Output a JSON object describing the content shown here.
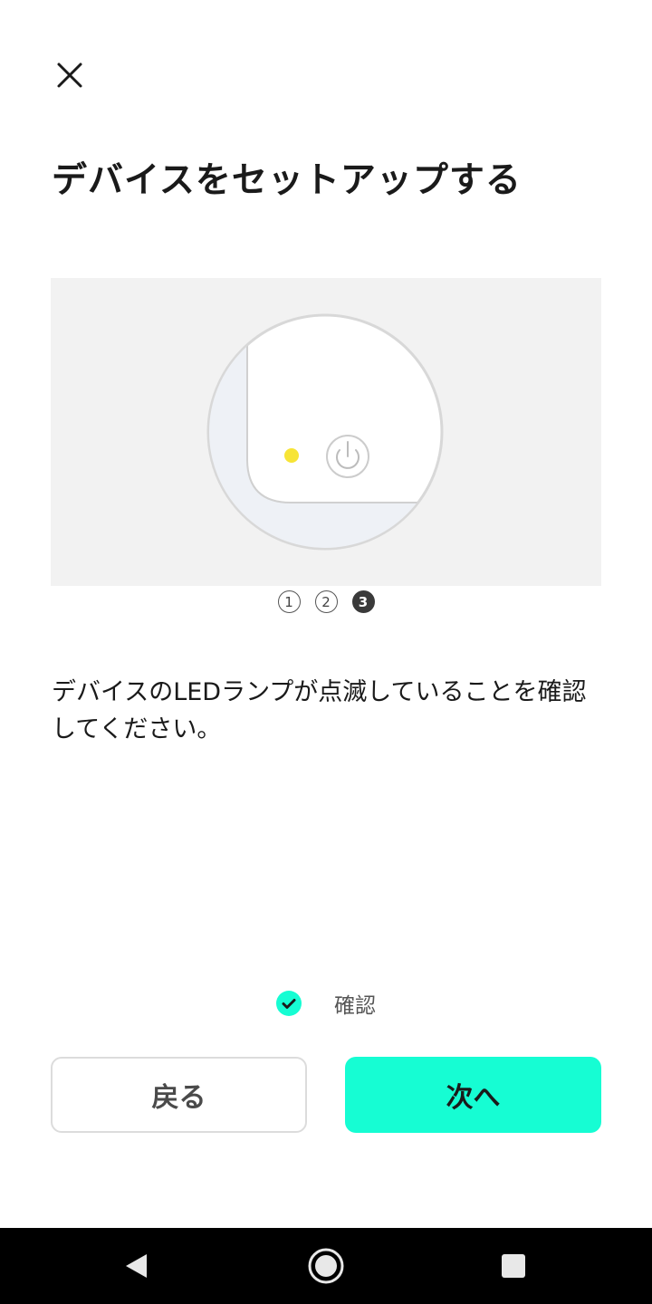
{
  "header": {
    "close_icon": "close-icon",
    "title": "デバイスをセットアップする"
  },
  "illustration": {
    "description_icon": "device-led-illustration",
    "led_color": "#f7e436"
  },
  "steps": {
    "items": [
      "1",
      "2",
      "3"
    ],
    "current": 3
  },
  "instruction": {
    "text": "デバイスのLEDランプが点滅していることを確認してください。"
  },
  "confirm": {
    "checked": true,
    "label": "確認"
  },
  "buttons": {
    "back_label": "戻る",
    "next_label": "次へ"
  },
  "colors": {
    "accent": "#16fdd3",
    "text": "#1a1a1a"
  },
  "system_nav": {
    "back_icon": "back-triangle-icon",
    "home_icon": "home-circle-icon",
    "recents_icon": "recents-square-icon"
  }
}
